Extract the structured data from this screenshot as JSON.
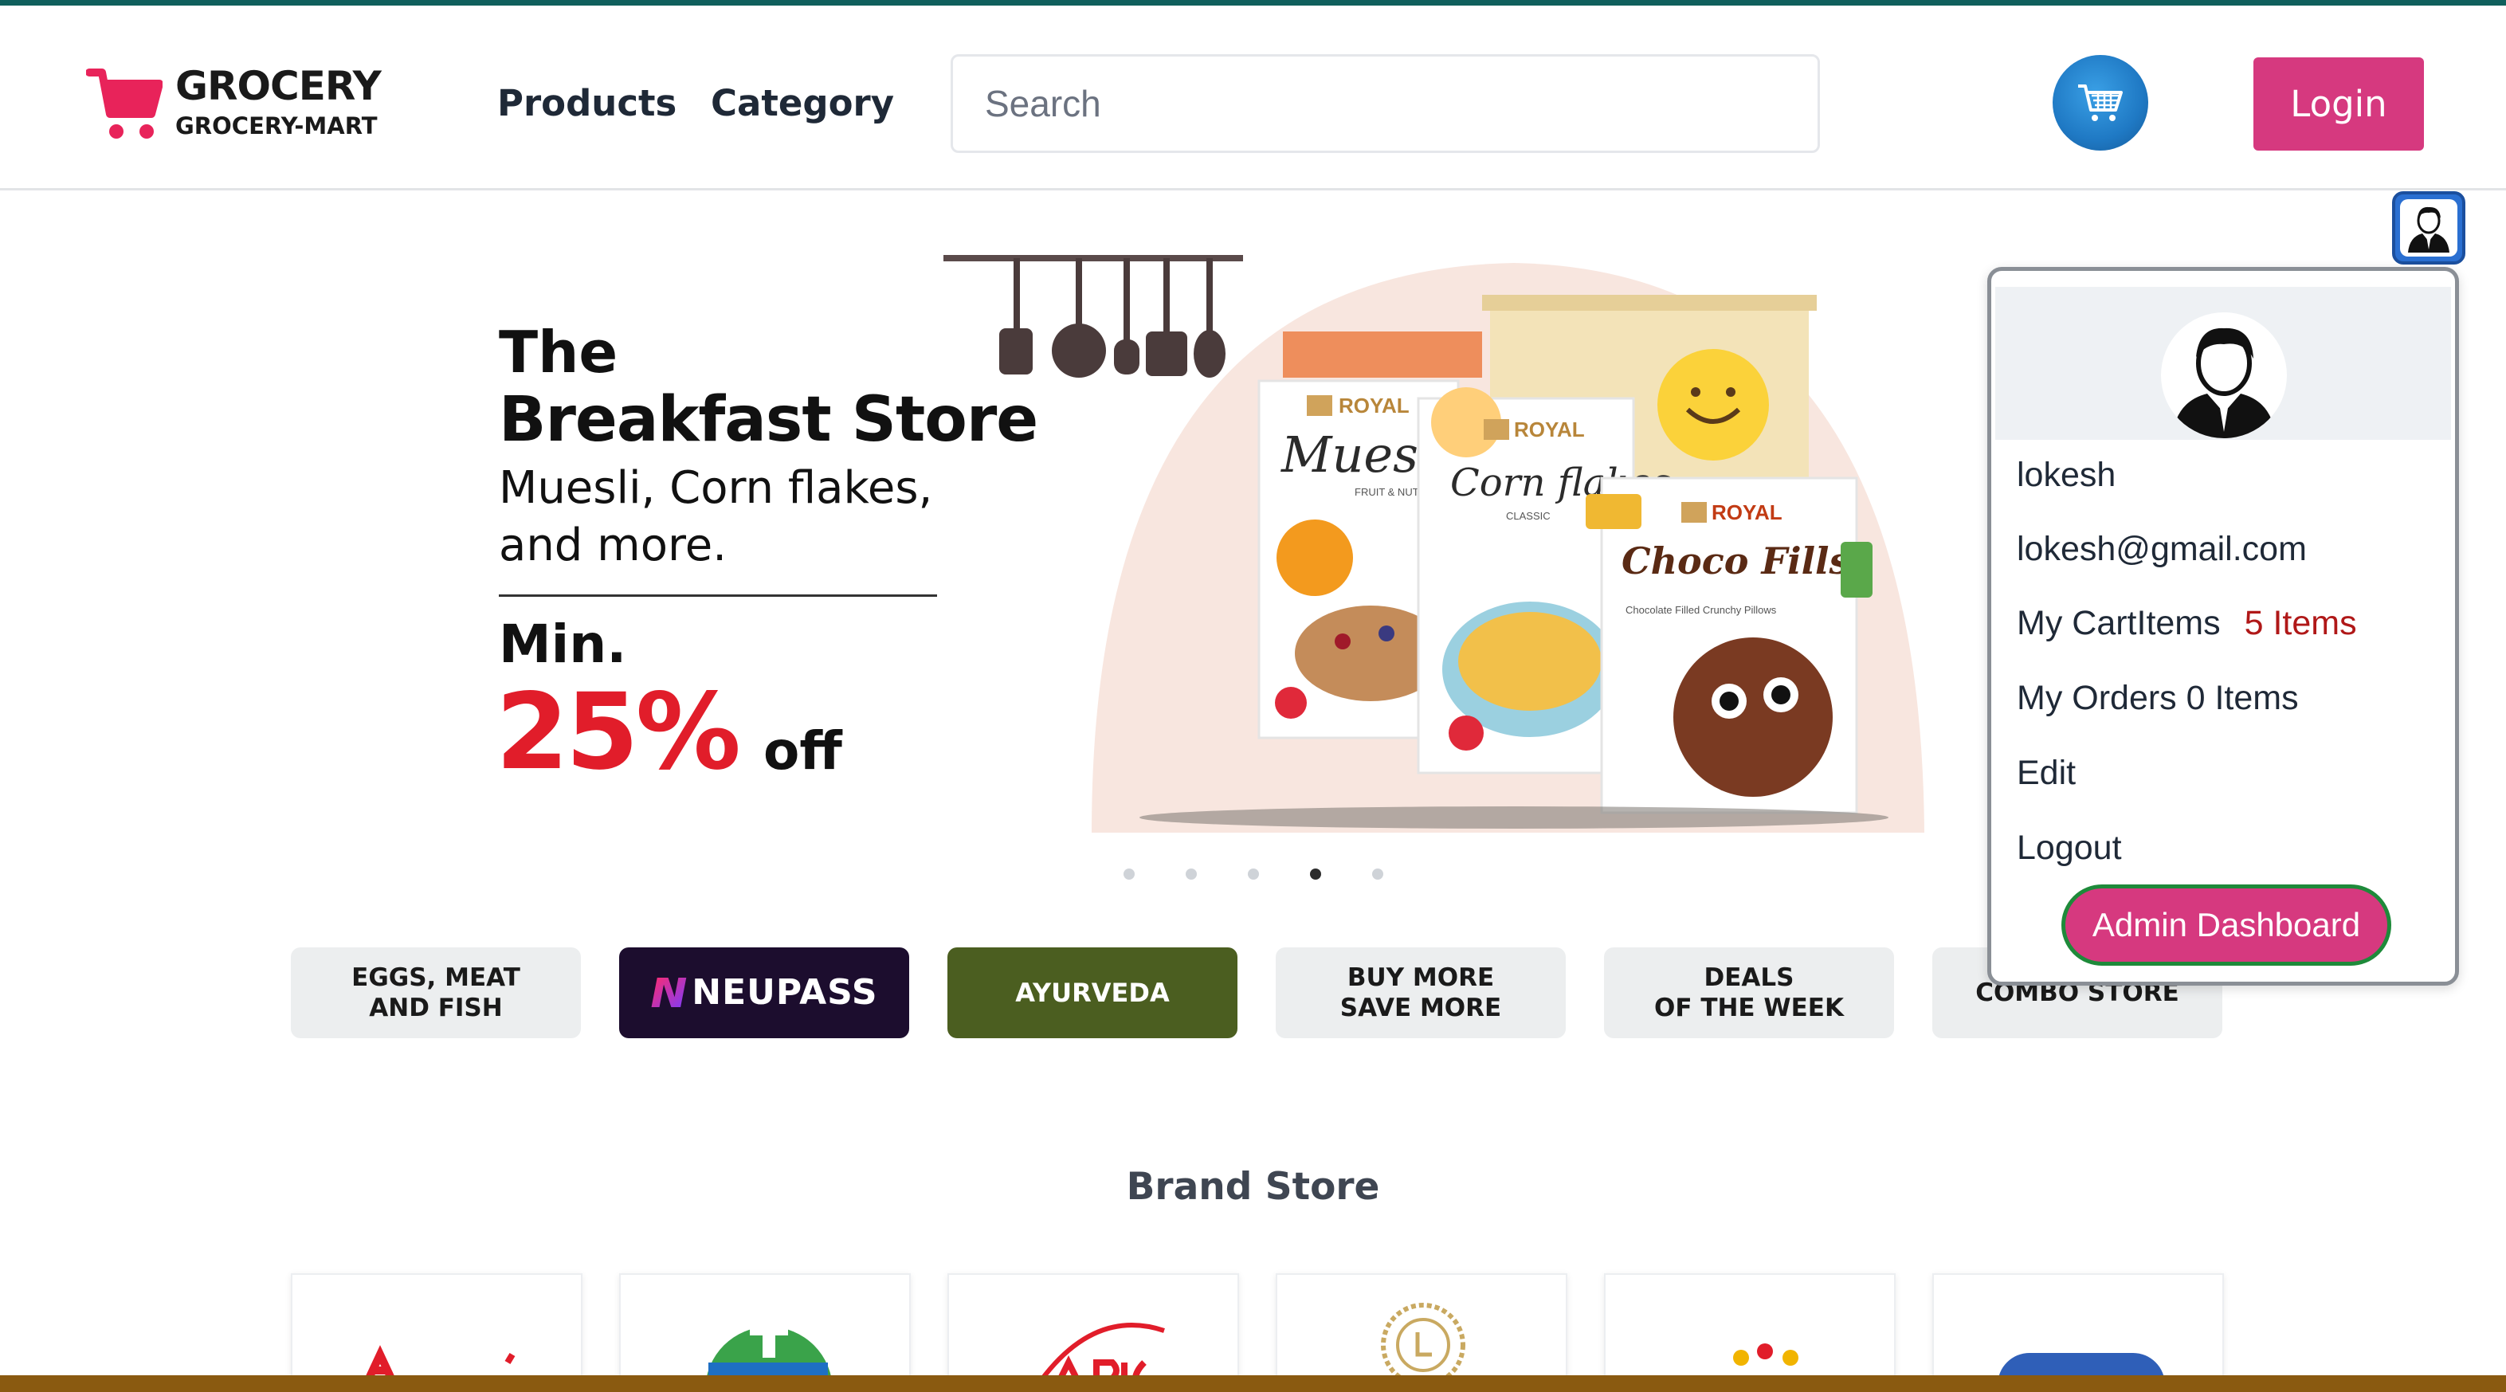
{
  "brand": {
    "title": "GROCERY",
    "subtitle": "GROCERY-MART",
    "accent_color": "#e8235a",
    "icon": "cart-icon"
  },
  "nav": {
    "products": "Products",
    "category": "Category"
  },
  "search": {
    "placeholder": "Search",
    "value": ""
  },
  "header": {
    "cart_icon": "cart-icon",
    "login_label": "Login",
    "login_color": "#d6397f"
  },
  "hero": {
    "line1": "The",
    "line2": "Breakfast Store",
    "line3": "Muesli, Corn flakes,",
    "line4": "and more.",
    "min_label": "Min.",
    "discount": "25%",
    "off_label": "off",
    "slide_count": 5,
    "active_slide": 4,
    "products": {
      "brand_label": "ROYAL",
      "muesli": "Muesli",
      "muesli_sub": "FRUIT & NUT",
      "cornflakes": "Corn flakes",
      "cornflakes_sub": "CLASSIC",
      "choco": "Choco Fills",
      "choco_sub": "Chocolate Filled Crunchy Pillows"
    }
  },
  "categories": [
    {
      "label": "EGGS, MEAT\nAND FISH"
    },
    {
      "label": "NEUPASS"
    },
    {
      "label": "AYURVEDA"
    },
    {
      "label": "BUY MORE\nSAVE MORE"
    },
    {
      "label": "DEALS\nOF THE WEEK"
    },
    {
      "label": "COMBO STORE"
    }
  ],
  "brand_store": {
    "heading": "Brand Store"
  },
  "user_menu": {
    "username": "lokesh",
    "email": "lokesh@gmail.com",
    "cart_label": "My CartItems",
    "cart_count": "5 Items",
    "orders_label": "My Orders 0 Items",
    "edit_label": "Edit",
    "logout_label": "Logout",
    "admin_label": "Admin Dashboard"
  }
}
